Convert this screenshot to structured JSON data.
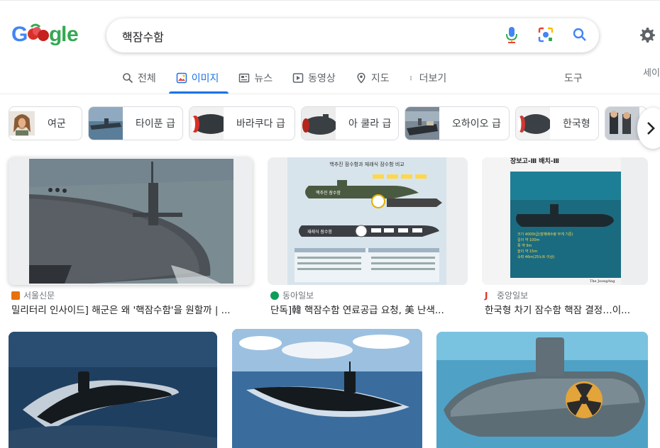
{
  "header": {
    "logo_alt": "Google",
    "search_query": "핵잠수함",
    "settings_icon": "gear-icon",
    "signin_label": "세이"
  },
  "tabs": [
    {
      "label": "전체",
      "icon": "search-icon",
      "active": false
    },
    {
      "label": "이미지",
      "icon": "image-icon",
      "active": true
    },
    {
      "label": "뉴스",
      "icon": "news-icon",
      "active": false
    },
    {
      "label": "동영상",
      "icon": "play-icon",
      "active": false
    },
    {
      "label": "지도",
      "icon": "map-pin-icon",
      "active": false
    },
    {
      "label": "더보기",
      "icon": "more-vert-icon",
      "active": false
    }
  ],
  "tools_label": "도구",
  "chips": [
    {
      "label": "여군"
    },
    {
      "label": "타이푼 급"
    },
    {
      "label": "바라쿠다 급"
    },
    {
      "label": "아 쿨라 급"
    },
    {
      "label": "오하이오 급"
    },
    {
      "label": "한국형"
    },
    {
      "label": ""
    }
  ],
  "results": [
    {
      "source": "서울신문",
      "title": "밀리터리 인사이드] 해군은 왜 '핵잠수함'을 원할까 | ...",
      "fav_color": "#e8710a"
    },
    {
      "source": "동아일보",
      "title": "단독]韓 핵잠수함 연료공급 요청, 美 난색...",
      "fav_color": "#0f9d58"
    },
    {
      "source": "중앙일보",
      "title": "한국형 차기 잠수함 핵잠 결정…이...",
      "fav_color": "#d93025"
    }
  ],
  "infographic_2": {
    "heading": "핵추진 잠수함과 재래식 잠수함 비교",
    "top_label": "핵추진 잠수함",
    "bottom_label": "재래식 잠수함"
  },
  "infographic_3": {
    "heading": "장보고-Ⅲ 배치-Ⅲ",
    "lines": [
      "크기 4000t급(잠재배수량 무게 기준)",
      "길이 약 100m",
      "폭 약 9m",
      "높이 약 15m",
      "속력 46m(25노트 이상)"
    ],
    "credit": "The JoongAng"
  }
}
